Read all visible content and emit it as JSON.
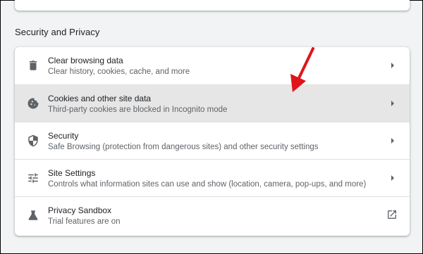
{
  "section": {
    "title": "Security and Privacy"
  },
  "rows": [
    {
      "label": "Clear browsing data",
      "sublabel": "Clear history, cookies, cache, and more",
      "icon": "trash-icon",
      "trailing": "chevron-right-icon"
    },
    {
      "label": "Cookies and other site data",
      "sublabel": "Third-party cookies are blocked in Incognito mode",
      "icon": "cookie-icon",
      "trailing": "chevron-right-icon",
      "highlighted": true
    },
    {
      "label": "Security",
      "sublabel": "Safe Browsing (protection from dangerous sites) and other security settings",
      "icon": "shield-icon",
      "trailing": "chevron-right-icon"
    },
    {
      "label": "Site Settings",
      "sublabel": "Controls what information sites can use and show (location, camera, pop-ups, and more)",
      "icon": "sliders-icon",
      "trailing": "chevron-right-icon"
    },
    {
      "label": "Privacy Sandbox",
      "sublabel": "Trial features are on",
      "icon": "flask-icon",
      "trailing": "open-in-new-icon"
    }
  ],
  "annotation": {
    "arrow_color": "#e0141b",
    "highlight_color": "#e6e6e6"
  }
}
